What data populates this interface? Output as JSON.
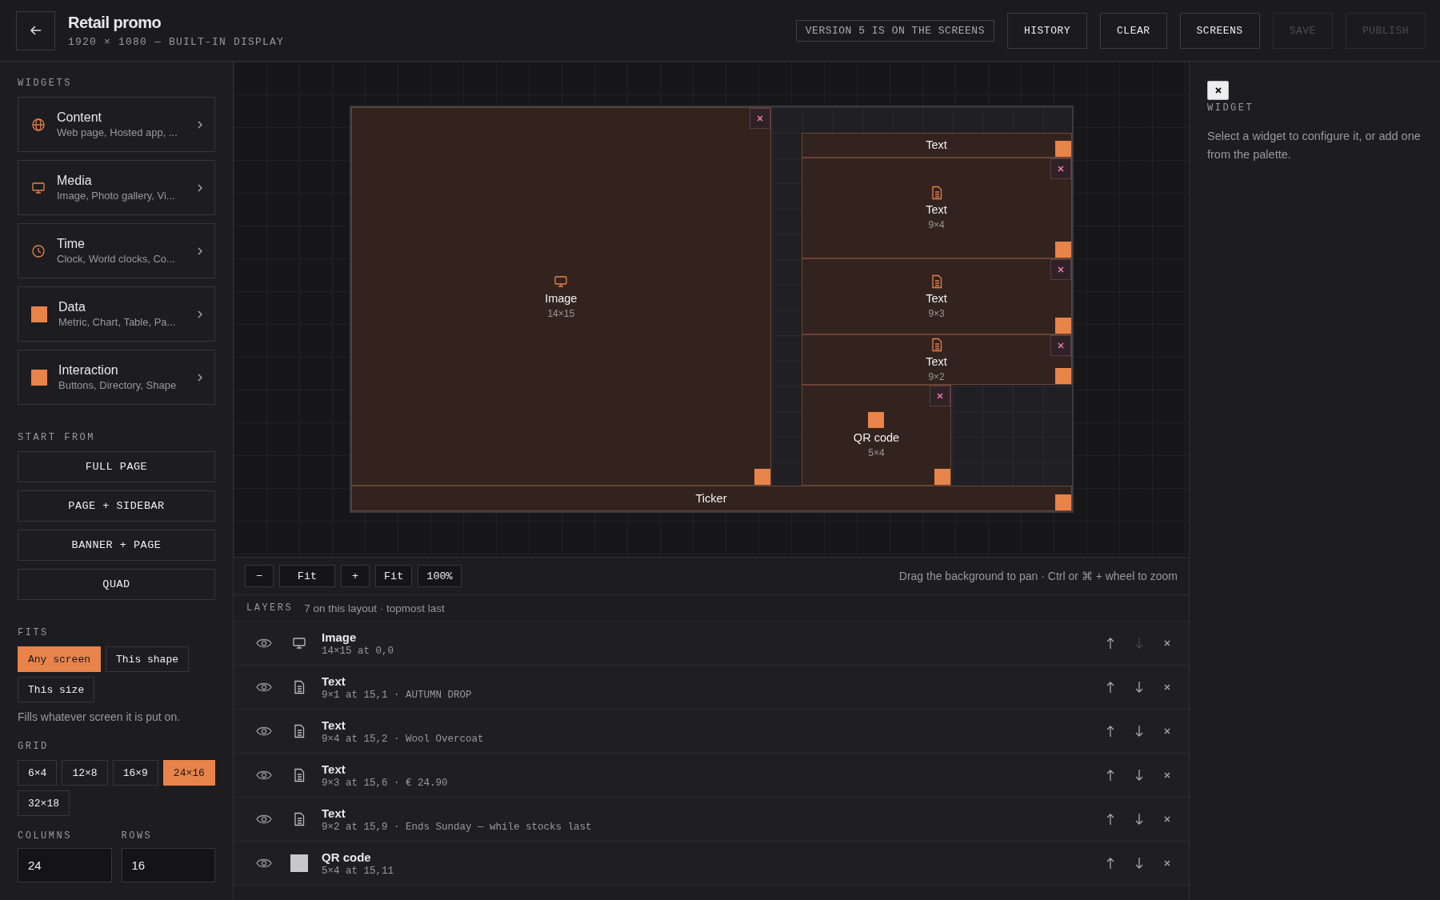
{
  "header": {
    "title": "Retail promo",
    "subtitle": "1920 × 1080 — BUILT-IN DISPLAY",
    "status": "VERSION 5 IS ON THE SCREENS",
    "buttons": [
      {
        "label": "HISTORY",
        "disabled": false
      },
      {
        "label": "CLEAR",
        "disabled": false
      },
      {
        "label": "SCREENS",
        "disabled": false
      },
      {
        "label": "SAVE",
        "disabled": true
      },
      {
        "label": "PUBLISH",
        "disabled": true
      }
    ]
  },
  "sidebar": {
    "widgets_label": "WIDGETS",
    "widgets": [
      {
        "title": "Content",
        "subtitle": "Web page, Hosted app, ..."
      },
      {
        "title": "Media",
        "subtitle": "Image, Photo gallery, Vi..."
      },
      {
        "title": "Time",
        "subtitle": "Clock, World clocks, Co..."
      },
      {
        "title": "Data",
        "subtitle": "Metric, Chart, Table, Pa..."
      },
      {
        "title": "Interaction",
        "subtitle": "Buttons, Directory, Shape"
      }
    ],
    "start_label": "START FROM",
    "start_buttons": [
      "FULL PAGE",
      "PAGE + SIDEBAR",
      "BANNER + PAGE",
      "QUAD"
    ],
    "fits_label": "FITS",
    "fits": [
      {
        "label": "Any screen",
        "selected": true
      },
      {
        "label": "This shape",
        "selected": false
      },
      {
        "label": "This size",
        "selected": false
      }
    ],
    "fits_help": "Fills whatever screen it is put on.",
    "grid_label": "GRID",
    "grids": [
      {
        "label": "6×4",
        "selected": false
      },
      {
        "label": "12×8",
        "selected": false
      },
      {
        "label": "16×9",
        "selected": false
      },
      {
        "label": "24×16",
        "selected": true
      },
      {
        "label": "32×18",
        "selected": false
      }
    ],
    "columns": {
      "label": "COLUMNS",
      "value": "24"
    },
    "rows": {
      "label": "ROWS",
      "value": "16"
    }
  },
  "canvas": {
    "widgets": [
      {
        "kind": "image",
        "name": "Image",
        "size": "14×15"
      },
      {
        "name": "Text"
      },
      {
        "kind": "text",
        "name": "Text",
        "size": "9×4"
      },
      {
        "kind": "text",
        "name": "Text",
        "size": "9×3"
      },
      {
        "kind": "text",
        "name": "Text",
        "size": "9×2"
      },
      {
        "kind": "qr",
        "name": "QR code",
        "size": "5×4"
      },
      {
        "name": "Ticker"
      }
    ]
  },
  "toolbar": {
    "buttons": [
      "−",
      "Fit",
      "+",
      "Fit",
      "100%"
    ],
    "hint": "Drag the background to pan · Ctrl or ⌘ + wheel to zoom"
  },
  "layers": {
    "label": "LAYERS",
    "summary": "7 on this layout · topmost last",
    "rows": [
      {
        "kind": "image",
        "name": "Image",
        "meta": "14×15 at 0,0",
        "down_enabled": false
      },
      {
        "kind": "text",
        "name": "Text",
        "meta": "9×1 at 15,1 · AUTUMN DROP",
        "down_enabled": true
      },
      {
        "kind": "text",
        "name": "Text",
        "meta": "9×4 at 15,2 · Wool Overcoat",
        "down_enabled": true
      },
      {
        "kind": "text",
        "name": "Text",
        "meta": "9×3 at 15,6 · € 24.90",
        "down_enabled": true
      },
      {
        "kind": "text",
        "name": "Text",
        "meta": "9×2 at 15,9 · Ends Sunday — while stocks last",
        "down_enabled": true
      },
      {
        "kind": "qr",
        "name": "QR code",
        "meta": "5×4 at 15,11",
        "down_enabled": true
      }
    ]
  },
  "inspector": {
    "label": "WIDGET",
    "help": "Select a widget to configure it, or add one from the palette."
  }
}
